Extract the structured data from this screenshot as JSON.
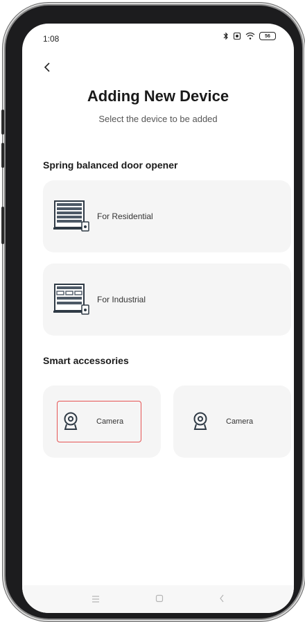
{
  "status_bar": {
    "time": "1:08",
    "icons": [
      "bluetooth-icon",
      "alarm-icon",
      "wifi-icon",
      "battery-icon"
    ],
    "battery_level": "56"
  },
  "header": {
    "back_icon": "chevron-left-icon",
    "title": "Adding New Device",
    "subtitle": "Select the device to be added"
  },
  "sections": [
    {
      "title": "Spring balanced door opener",
      "items": [
        {
          "label": "For Residential",
          "icon": "residential-door-opener-icon"
        },
        {
          "label": "For Industrial",
          "icon": "industrial-door-opener-icon"
        }
      ]
    },
    {
      "title": "Smart accessories",
      "items": [
        {
          "label": "Camera",
          "icon": "camera-icon",
          "selected": true
        },
        {
          "label": "Camera",
          "icon": "camera-icon",
          "selected": false
        }
      ]
    }
  ],
  "nav_bar": {
    "items": [
      "menu-icon",
      "home-icon",
      "back-icon"
    ]
  },
  "colors": {
    "selection_border": "#e55353",
    "card_background": "#f5f5f5",
    "title_text": "#1a1a1a"
  }
}
